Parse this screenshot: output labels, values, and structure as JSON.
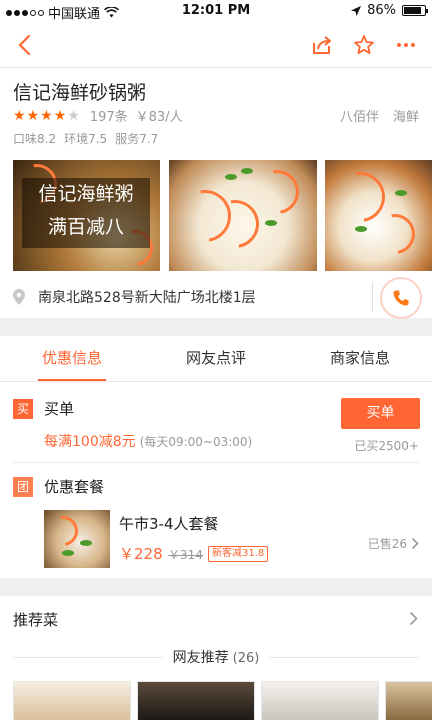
{
  "status_bar": {
    "carrier": "中国联通",
    "time": "12:01 PM",
    "battery": "86%",
    "battery_level": 0.86
  },
  "nav": {
    "back_icon": "chevron-left-icon",
    "share_icon": "share-icon",
    "favorite_icon": "star-outline-icon",
    "more_icon": "more-icon",
    "accent_color": "#ff6633"
  },
  "shop": {
    "name": "信记海鲜砂锅粥",
    "rating": 4,
    "rating_max": 5,
    "review_count": "197条",
    "avg_price": "￥83/人",
    "tags": [
      "八佰伴",
      "海鲜"
    ],
    "scores": [
      "口味8.2",
      "环境7.5",
      "服务7.7"
    ],
    "photo_banner_lines": [
      "信记海鲜粥",
      "满百减八"
    ],
    "address": "南泉北路528号新大陆广场北楼1层"
  },
  "tabs": [
    {
      "label": "优惠信息",
      "active": true
    },
    {
      "label": "网友点评",
      "active": false
    },
    {
      "label": "商家信息",
      "active": false
    }
  ],
  "deals": {
    "buy": {
      "badge": "买",
      "title": "买单",
      "button": "买单",
      "promo": "每满100减8元",
      "hours": "(每天09:00~03:00)",
      "bought": "已买2500+"
    },
    "set": {
      "badge": "团",
      "title": "优惠套餐",
      "name": "午市3-4人套餐",
      "price": "￥228",
      "original_price": "￥314",
      "tag": "新客减31.8",
      "sold": "已售26"
    }
  },
  "recommend": {
    "title": "推荐菜",
    "friends_label": "网友推荐",
    "friends_count": "(26)"
  }
}
